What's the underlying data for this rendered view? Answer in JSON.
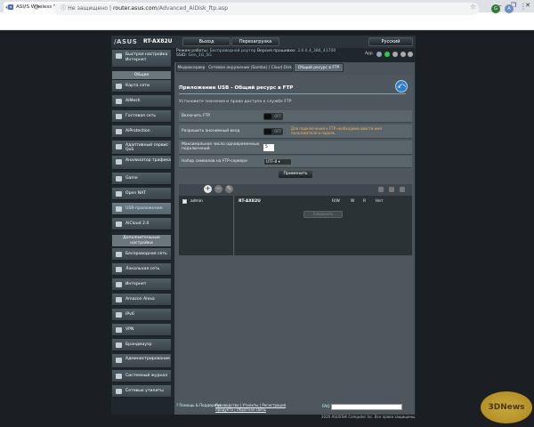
{
  "browser": {
    "tab_title": "ASUS Wireless Router RT-AX82U",
    "tab_close": "×",
    "new_tab": "+",
    "nav": [
      "←",
      "→",
      "⟳"
    ],
    "security": "Не защищено",
    "url_host": "router.asus.com",
    "url_path": "/Advanced_AiDisk_ftp.asp",
    "window_controls": [
      "–",
      "❐",
      "✕"
    ],
    "profile_letter": "A",
    "ext_letter": "G",
    "bookmark_icon": "☆",
    "menu_icon": "⋮"
  },
  "router": {
    "brand": "/ASUS",
    "model": "RT-AX82U",
    "logout": "Выход",
    "reboot": "Перезагрузка",
    "language": "Русский",
    "info_line1": "Режим работы:",
    "mode": "Беспроводной роутер",
    "fw_label": "Версия прошивки:",
    "fw": "3.0.0.4_386_41700",
    "ssid_label": "SSID:",
    "ssid": "Gen_1G_5G",
    "app_label": "App"
  },
  "sidebar": {
    "quick": "Быстрая настройка Интернет",
    "general_header": "Общие",
    "general": [
      "Карта сети",
      "AiMesh",
      "Гостевая сеть",
      "AiProtection",
      "Адаптивный сервис QoS",
      "Анализатор трафика",
      "Game",
      "Open NAT",
      "USB-приложение",
      "AiCloud 2.0"
    ],
    "advanced_header": "Дополнительные настройки",
    "advanced": [
      "Беспроводная сеть",
      "Локальная сеть",
      "Интернет",
      "Amazon Alexa",
      "IPv6",
      "VPN",
      "Брандмауэр",
      "Администрирование",
      "Системный журнал",
      "Сетевые утилиты"
    ]
  },
  "tabs": [
    "Медиасервер",
    "Сетевое окружение (Samba) / Cloud Disk",
    "Общий ресурс в FTP"
  ],
  "panel": {
    "title": "Приложение USB - Общий ресурс в FTP",
    "desc": "Установите значения и права доступа к службе FTP",
    "rows": [
      {
        "label": "Включить FTP",
        "value": "OFF"
      },
      {
        "label": "Разрешить анонимный вход",
        "value": "OFF",
        "warn": "Для подключения к FTP необходимо ввести имя пользователя и пароль."
      },
      {
        "label": "Максимальное число одновременных подключений",
        "value": "5"
      },
      {
        "label": "Набор символов на FTP-сервере",
        "value": "UTF-8"
      }
    ],
    "apply": "Применить",
    "user": "admin",
    "folder": "RT-AX82U",
    "perms": [
      "R/W",
      "W",
      "R",
      "Нет"
    ],
    "disabled_btn": "Сохранить"
  },
  "footer": {
    "help": "Помощь & Поддержка",
    "links": "Руководство | Утилиты | Регистрация продукта | Обратная связь",
    "faq": "FAQ",
    "copyright": "2020 ASUSTeK Computer Inc. Все права защищены."
  },
  "watermark": "3DNews"
}
